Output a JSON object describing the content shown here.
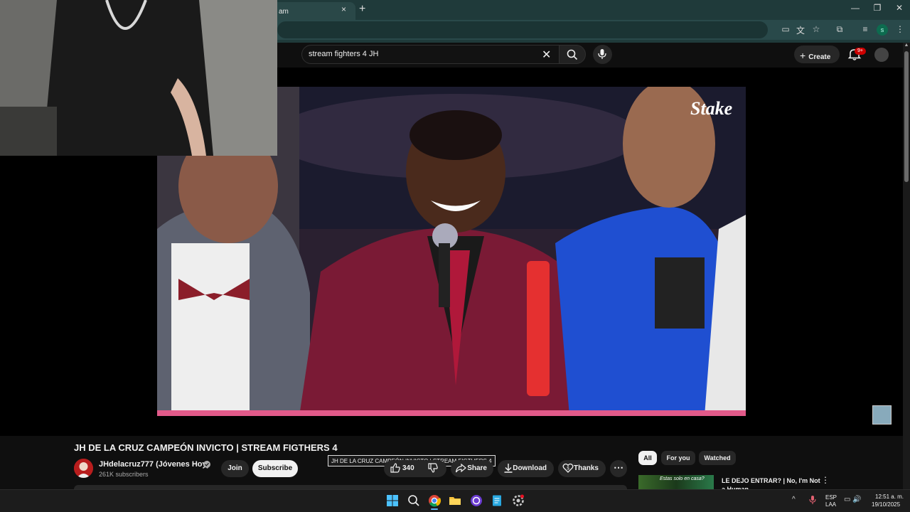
{
  "browser": {
    "tab_title": "am",
    "tab_close": "×",
    "new_tab": "+",
    "window_controls": {
      "minimize": "—",
      "restore": "❐",
      "close": "✕"
    },
    "profile_initial": "s"
  },
  "header": {
    "search": {
      "value": "stream fighters 4 JH",
      "clear": "✕"
    },
    "create_label": "Create",
    "create_plus": "+",
    "notifications_badge": "9+"
  },
  "player": {
    "sponsor_logo": "Stake"
  },
  "video": {
    "title": "JH DE LA CRUZ CAMPEÓN INVICTO | STREAM FIGTHERS 4",
    "title_tooltip": "JH DE LA CRUZ CAMPEÓN INVICTO | STREAM FIGTHERS 4",
    "channel_name": "JHdelacruz777 (Jóvenes Hoy)",
    "subscribers": "261K subscribers",
    "join_label": "Join",
    "subscribe_label": "Subscribe",
    "like_count": "340",
    "share_label": "Share",
    "download_label": "Download",
    "thanks_label": "Thanks",
    "more_label": "⋯"
  },
  "sidebar": {
    "chips": [
      "All",
      "For you",
      "Watched"
    ],
    "recommendation": {
      "title": "LE DEJO ENTRAR? | No, I'm Not a Human",
      "thumb_caption": "Estas solo en casa?",
      "more": "⋮"
    }
  },
  "taskbar": {
    "tray_up": "^",
    "lang_line1": "ESP",
    "lang_line2": "LAA",
    "tray_icons": "▭ 🔊",
    "time": "12:51 a. m.",
    "date": "19/10/2025"
  },
  "colors": {
    "accent_red": "#cc0000",
    "chrome_teal": "#1f3a3a",
    "bg": "#0f0f0f"
  }
}
